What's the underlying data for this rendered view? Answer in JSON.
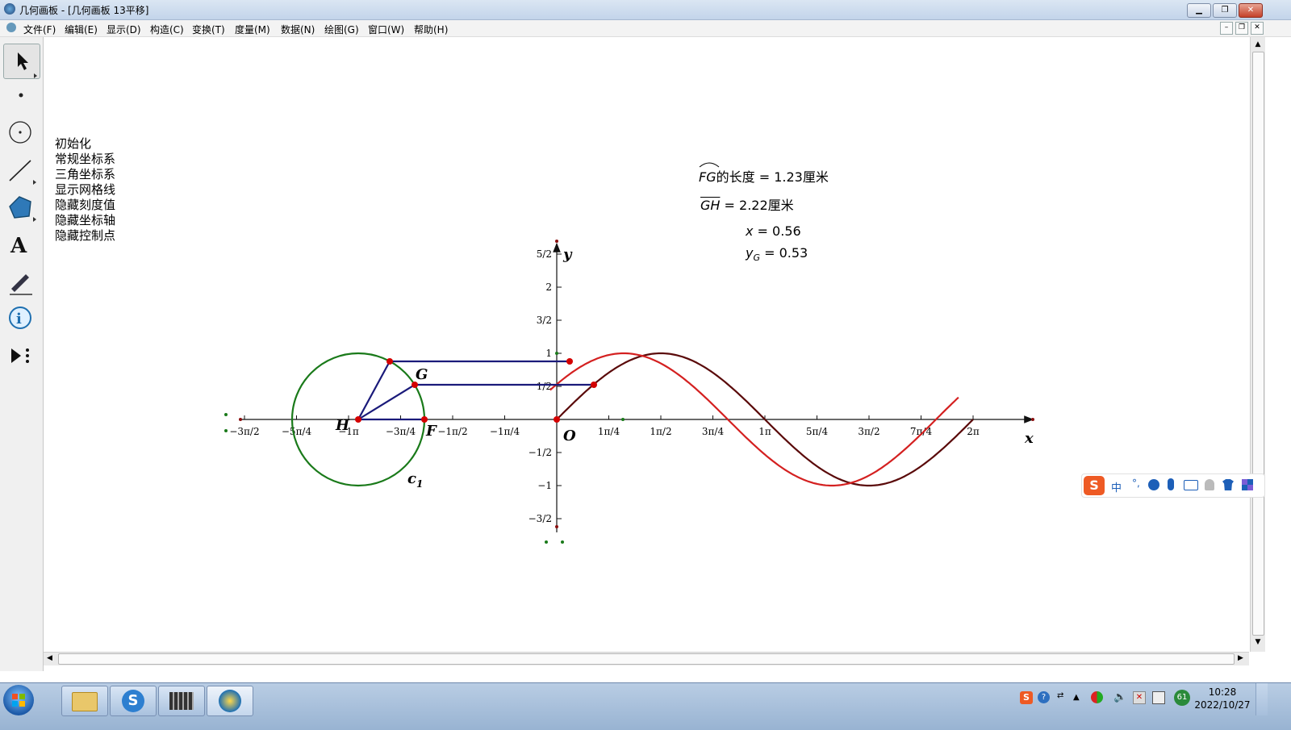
{
  "window": {
    "title": "几何画板 - [几何画板 13平移]"
  },
  "menu": [
    "文件(F)",
    "编辑(E)",
    "显示(D)",
    "构造(C)",
    "变换(T)",
    "度量(M)",
    "数据(N)",
    "绘图(G)",
    "窗口(W)",
    "帮助(H)"
  ],
  "commands": [
    "初始化",
    "常规坐标系",
    "三角坐标系",
    "显示网格线",
    "隐藏刻度值",
    "隐藏坐标轴",
    "隐藏控制点"
  ],
  "measures": {
    "arc_name": "FG",
    "arc_text": "的长度 = 1.23厘米",
    "seg_name": "GH",
    "seg_text": " = 2.22厘米",
    "x_name": "x",
    "x_text": " = 0.56",
    "y_name": "y",
    "y_sub": "G",
    "y_text": " = 0.53"
  },
  "axes": {
    "x_ticks": [
      "−3π/2",
      "−5π/4",
      "−1π",
      "−3π/4",
      "−1π/2",
      "−1π/4",
      "1π/4",
      "1π/2",
      "3π/4",
      "1π",
      "5π/4",
      "3π/2",
      "7π/4",
      "2π"
    ],
    "y_ticks": [
      "5/2",
      "2",
      "3/2",
      "1",
      "1/2",
      "−1/2",
      "−1",
      "−3/2"
    ],
    "x_label": "x",
    "y_label": "y"
  },
  "points": {
    "H": "H",
    "G": "G",
    "F": "F",
    "O": "O",
    "circle": "c",
    "circle_sub": "1"
  },
  "colors": {
    "circle": "#1a7a1a",
    "sine_red": "#d42020",
    "sine_dark": "#5a0a0a",
    "segments": "#1a1a7a",
    "points": "#d40000"
  },
  "taskbar": {
    "time": "10:28",
    "date": "2022/10/27",
    "badge": "61"
  },
  "ime": {
    "mode": "中"
  }
}
